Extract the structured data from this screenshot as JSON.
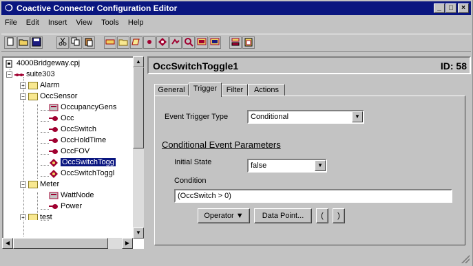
{
  "window": {
    "title": "Coactive Connector Configuration Editor",
    "minimize_label": "_",
    "maximize_label": "□",
    "close_label": "×"
  },
  "menu": [
    "File",
    "Edit",
    "Insert",
    "View",
    "Tools",
    "Help"
  ],
  "toolbar": {
    "buttons": [
      "new-icon",
      "open-icon",
      "save-icon",
      "cut-icon",
      "copy-icon",
      "paste-icon",
      "link-icon",
      "folder-icon",
      "shape-icon",
      "point-icon",
      "sensor-icon",
      "switch-icon",
      "query-icon",
      "monitor-icon",
      "monitor2-icon",
      "stack-icon",
      "clipboard-icon"
    ]
  },
  "tree": {
    "root": "4000Bridgeway.cpj",
    "items": {
      "suite": "suite303",
      "alarm": "Alarm",
      "occsensor": "OccSensor",
      "occupancy": "OccupancyGens",
      "occ": "Occ",
      "occswitch": "OccSwitch",
      "occholdtime": "OccHoldTime",
      "occfov": "OccFOV",
      "occswitchtoggle": "OccSwitchTogg",
      "occswitchtoggle2": "OccSwitchToggl",
      "meter": "Meter",
      "wattnode": "WattNode",
      "power": "Power",
      "test": "test"
    }
  },
  "detail": {
    "name": "OccSwitchToggle1",
    "id": "ID: 58",
    "tabs": [
      "General",
      "Trigger",
      "Filter",
      "Actions"
    ],
    "active_tab": "Trigger",
    "event_trigger_type_label": "Event Trigger Type",
    "event_trigger_type_value": "Conditional",
    "section_title": "Conditional Event Parameters",
    "initial_state_label": "Initial State",
    "initial_state_value": "false",
    "condition_label": "Condition",
    "condition_value": "(OccSwitch > 0)",
    "operator_button": "Operator ▼",
    "datapoint_button": "Data Point...",
    "open_paren_button": "(",
    "close_paren_button": ")"
  },
  "colors": {
    "titlebar": "#0a1680",
    "window_bg": "#c3c3c3",
    "selection": "#0a1680"
  }
}
